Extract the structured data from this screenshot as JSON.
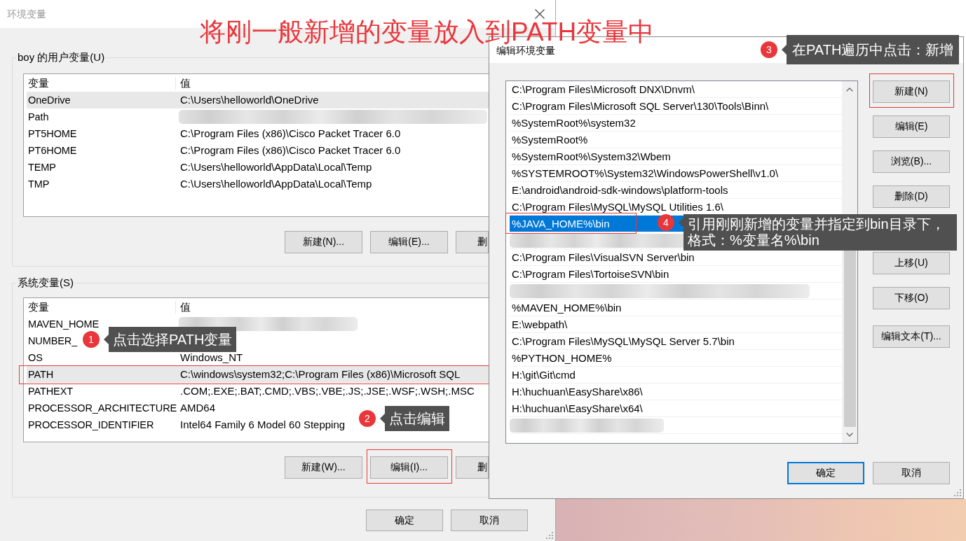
{
  "annotation_title": "将刚一般新增的变量放入到PATH变量中",
  "env_dialog": {
    "title": "环境变量",
    "user_vars": {
      "label": "boy 的用户变量(U)",
      "columns": [
        "变量",
        "值"
      ],
      "rows": [
        {
          "name": "OneDrive",
          "value": "C:\\Users\\helloworld\\OneDrive",
          "blurred": false,
          "selected": true,
          "highlighted": false
        },
        {
          "name": "Path",
          "blurred": true,
          "selected": false,
          "highlighted": false
        },
        {
          "name": "PT5HOME",
          "value": "C:\\Program Files (x86)\\Cisco Packet Tracer 6.0",
          "blurred": false,
          "selected": false,
          "highlighted": false
        },
        {
          "name": "PT6HOME",
          "value": "C:\\Program Files (x86)\\Cisco Packet Tracer 6.0",
          "blurred": false,
          "selected": false,
          "highlighted": false
        },
        {
          "name": "TEMP",
          "value": "C:\\Users\\helloworld\\AppData\\Local\\Temp",
          "blurred": false,
          "selected": false,
          "highlighted": false
        },
        {
          "name": "TMP",
          "value": "C:\\Users\\helloworld\\AppData\\Local\\Temp",
          "blurred": false,
          "selected": false,
          "highlighted": false
        }
      ],
      "buttons": [
        {
          "label": "新建(N)...",
          "kind": "full",
          "highlighted": false
        },
        {
          "label": "编辑(E)...",
          "kind": "full",
          "highlighted": false
        },
        {
          "label": "删",
          "kind": "clipped",
          "highlighted": false
        }
      ]
    },
    "system_vars": {
      "label": "系统变量(S)",
      "columns": [
        "变量",
        "值"
      ],
      "rows": [
        {
          "name": "MAVEN_HOME",
          "blurred": true,
          "selected": false,
          "highlighted": false
        },
        {
          "name": "NUMBER_",
          "blurred": false,
          "selected": false,
          "highlighted": false
        },
        {
          "name": "OS",
          "value": "Windows_NT",
          "blurred": false,
          "selected": false,
          "highlighted": false
        },
        {
          "name": "PATH",
          "value": "C:\\windows\\system32;C:\\Program Files (x86)\\Microsoft SQL",
          "blurred": false,
          "selected": true,
          "highlighted": true
        },
        {
          "name": "PATHEXT",
          "value": ".COM;.EXE;.BAT;.CMD;.VBS;.VBE;.JS;.JSE;.WSF;.WSH;.MSC",
          "blurred": false,
          "selected": false,
          "highlighted": false
        },
        {
          "name": "PROCESSOR_ARCHITECTURE",
          "value": "AMD64",
          "blurred": false,
          "selected": false,
          "highlighted": false
        },
        {
          "name": "PROCESSOR_IDENTIFIER",
          "value": "Intel64 Family 6 Model 60 Stepping",
          "blurred": false,
          "selected": false,
          "highlighted": false
        }
      ],
      "buttons": [
        {
          "label": "新建(W)...",
          "kind": "full",
          "highlighted": false
        },
        {
          "label": "编辑(I)...",
          "kind": "full",
          "highlighted": true
        },
        {
          "label": "删",
          "kind": "clipped",
          "highlighted": false
        }
      ]
    },
    "buttons": [
      {
        "label": "确定",
        "default": false
      },
      {
        "label": "取消",
        "default": false
      }
    ]
  },
  "edit_dialog": {
    "title": "编辑环境变量",
    "items": [
      {
        "text": "C:\\Program Files\\Microsoft DNX\\Dnvm\\",
        "blurred": false,
        "selected": false,
        "highlighted": false
      },
      {
        "text": "C:\\Program Files\\Microsoft SQL Server\\130\\Tools\\Binn\\",
        "blurred": false,
        "selected": false,
        "highlighted": false
      },
      {
        "text": "%SystemRoot%\\system32",
        "blurred": false,
        "selected": false,
        "highlighted": false
      },
      {
        "text": "%SystemRoot%",
        "blurred": false,
        "selected": false,
        "highlighted": false
      },
      {
        "text": "%SystemRoot%\\System32\\Wbem",
        "blurred": false,
        "selected": false,
        "highlighted": false
      },
      {
        "text": "%SYSTEMROOT%\\System32\\WindowsPowerShell\\v1.0\\",
        "blurred": false,
        "selected": false,
        "highlighted": false
      },
      {
        "text": "E:\\android\\android-sdk-windows\\platform-tools",
        "blurred": false,
        "selected": false,
        "highlighted": false
      },
      {
        "text": "C:\\Program Files\\MySQL\\MySQL Utilities 1.6\\",
        "blurred": false,
        "selected": false,
        "highlighted": false
      },
      {
        "text": "%JAVA_HOME%\\bin",
        "blurred": false,
        "selected": true,
        "highlighted": true
      },
      {
        "blurred": true,
        "selected": false,
        "highlighted": false
      },
      {
        "text": "C:\\Program Files\\VisualSVN Server\\bin",
        "blurred": false,
        "selected": false,
        "highlighted": false
      },
      {
        "text": "C:\\Program Files\\TortoiseSVN\\bin",
        "blurred": false,
        "selected": false,
        "highlighted": false
      },
      {
        "blurred": true,
        "selected": false,
        "highlighted": false
      },
      {
        "text": "%MAVEN_HOME%\\bin",
        "blurred": false,
        "selected": false,
        "highlighted": false
      },
      {
        "text": "E:\\webpath\\",
        "blurred": false,
        "selected": false,
        "highlighted": false
      },
      {
        "text": "C:\\Program Files\\MySQL\\MySQL Server 5.7\\bin",
        "blurred": false,
        "selected": false,
        "highlighted": false
      },
      {
        "text": "%PYTHON_HOME%",
        "blurred": false,
        "selected": false,
        "highlighted": false
      },
      {
        "text": "H:\\git\\Git\\cmd",
        "blurred": false,
        "selected": false,
        "highlighted": false
      },
      {
        "text": "H:\\huchuan\\EasyShare\\x86\\",
        "blurred": false,
        "selected": false,
        "highlighted": false
      },
      {
        "text": "H:\\huchuan\\EasyShare\\x64\\",
        "blurred": false,
        "selected": false,
        "highlighted": false
      },
      {
        "blurred": true,
        "selected": false,
        "highlighted": false
      }
    ],
    "button_groups": [
      {
        "buttons": [
          {
            "label": "新建(N)",
            "highlighted": true
          },
          {
            "label": "编辑(E)",
            "highlighted": false
          },
          {
            "label": "浏览(B)...",
            "highlighted": false
          },
          {
            "label": "删除(D)",
            "highlighted": false
          }
        ]
      },
      {
        "buttons": [
          {
            "label": "上移(U)",
            "highlighted": false
          },
          {
            "label": "下移(O)",
            "highlighted": false
          }
        ]
      },
      {
        "buttons": [
          {
            "label": "编辑文本(T)...",
            "highlighted": false
          }
        ]
      }
    ],
    "buttons": [
      {
        "label": "确定",
        "default": true
      },
      {
        "label": "取消",
        "default": false
      }
    ]
  },
  "callouts": [
    {
      "number": "1",
      "text": "点击选择PATH变量"
    },
    {
      "number": "2",
      "text": "点击编辑"
    },
    {
      "number": "3",
      "text": "在PATH遍历中点击：新增"
    },
    {
      "number": "4",
      "text": "引用刚刚新增的变量并指定到bin目录下，格式：%变量名%\\bin"
    }
  ]
}
